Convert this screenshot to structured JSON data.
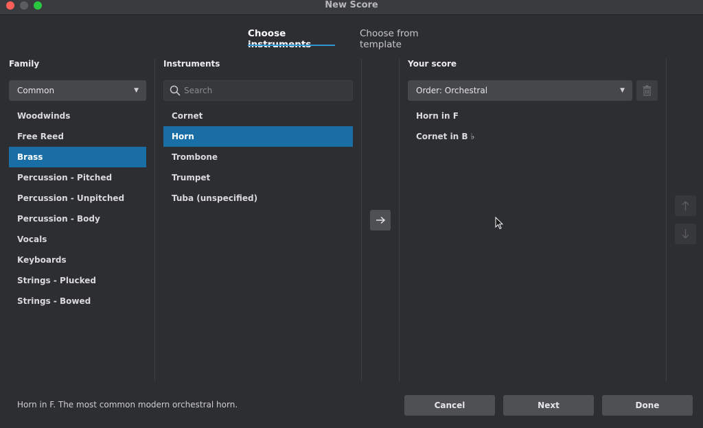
{
  "window": {
    "title": "New Score"
  },
  "tabs": [
    {
      "label": "Choose instruments",
      "active": true
    },
    {
      "label": "Choose from template",
      "active": false
    }
  ],
  "family": {
    "title": "Family",
    "dropdown_value": "Common",
    "items": [
      {
        "label": "Woodwinds"
      },
      {
        "label": "Free Reed"
      },
      {
        "label": "Brass",
        "selected": true
      },
      {
        "label": "Percussion - Pitched"
      },
      {
        "label": "Percussion - Unpitched"
      },
      {
        "label": "Percussion - Body"
      },
      {
        "label": "Vocals"
      },
      {
        "label": "Keyboards"
      },
      {
        "label": "Strings - Plucked"
      },
      {
        "label": "Strings - Bowed"
      }
    ]
  },
  "instruments": {
    "title": "Instruments",
    "search_placeholder": "Search",
    "items": [
      {
        "label": "Cornet"
      },
      {
        "label": "Horn",
        "selected": true
      },
      {
        "label": "Trombone"
      },
      {
        "label": "Trumpet"
      },
      {
        "label": "Tuba (unspecified)"
      }
    ]
  },
  "score": {
    "title": "Your score",
    "order_value": "Order: Orchestral",
    "items": [
      {
        "label": "Horn in F"
      },
      {
        "label": "Cornet in B ♭"
      }
    ]
  },
  "footer": {
    "description": "Horn in F. The most common modern orchestral horn.",
    "cancel_label": "Cancel",
    "next_label": "Next",
    "done_label": "Done"
  },
  "colors": {
    "accent": "#2f97d8",
    "selection": "#1a6ea6",
    "background": "#2d2e31"
  },
  "icons": {
    "search": "search-icon",
    "add": "arrow-right-icon",
    "delete": "trash-icon",
    "move_up": "arrow-up-icon",
    "move_down": "arrow-down-icon"
  }
}
